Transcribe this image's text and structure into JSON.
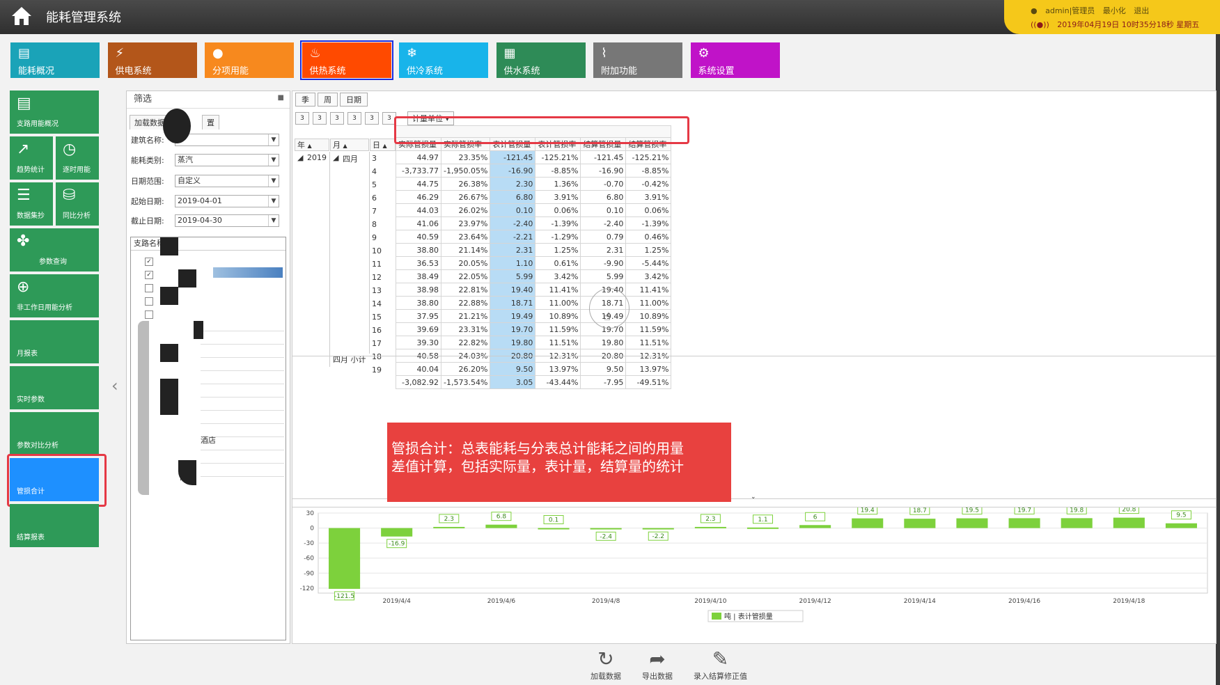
{
  "app": {
    "title": "能耗管理系统"
  },
  "user": {
    "name": "admin|管理员",
    "minimize": "最小化",
    "logout": "退出",
    "datetime": "2019年04月19日 10时35分18秒 星期五"
  },
  "nav": [
    {
      "label": "能耗概况",
      "icon": "dashboard-icon",
      "color": "#1aa3b8"
    },
    {
      "label": "供电系统",
      "icon": "power-icon",
      "color": "#b3561a"
    },
    {
      "label": "分项用能",
      "icon": "user-icon",
      "color": "#f7891e"
    },
    {
      "label": "供热系统",
      "icon": "fire-icon",
      "color": "#ff4a00"
    },
    {
      "label": "供冷系统",
      "icon": "snowflake-icon",
      "color": "#18b4ea"
    },
    {
      "label": "供水系统",
      "icon": "grid-icon",
      "color": "#2e8b57"
    },
    {
      "label": "附加功能",
      "icon": "pulse-icon",
      "color": "#777777"
    },
    {
      "label": "系统设置",
      "icon": "gear-icon",
      "color": "#c013c8"
    }
  ],
  "side": [
    {
      "label": "支路用能概况"
    },
    {
      "label": "趋势统计"
    },
    {
      "label": "逐时用能"
    },
    {
      "label": "数据集抄"
    },
    {
      "label": "同比分析"
    },
    {
      "label": "参数查询"
    },
    {
      "label": "非工作日用能分析"
    },
    {
      "label": "月报表"
    },
    {
      "label": "实时参数"
    },
    {
      "label": "参数对比分析"
    },
    {
      "label": "管损合计"
    },
    {
      "label": "结算报表"
    }
  ],
  "filter": {
    "title": "筛选",
    "tab1": "加载数据",
    "tab2": "置",
    "building_label": "建筑名称:",
    "building_value": "",
    "energy_label": "能耗类别:",
    "energy_value": "蒸汽",
    "range_label": "日期范围:",
    "range_value": "自定义",
    "start_label": "起始日期:",
    "start_value": "2019-04-01",
    "end_label": "截止日期:",
    "end_value": "2019-04-30",
    "branch_header": "支路名称",
    "branch_frag1": "酒店",
    "branch_frag2": "间"
  },
  "grid": {
    "period_tabs": [
      "季",
      "周",
      "日期"
    ],
    "small_btns": [
      "3",
      "3",
      "3",
      "3",
      "3",
      "3"
    ],
    "unit_button": "计量单位",
    "unit": "吨",
    "dims": [
      "年",
      "月",
      "日"
    ],
    "year": "2019",
    "month": "四月",
    "columns": [
      "实际管损量",
      "实际管损率",
      "表计管损量",
      "表计管损率",
      "结算管损量",
      "结算管损率"
    ],
    "rows": [
      {
        "day": "3",
        "v": [
          "44.97",
          "23.35%",
          "-121.45",
          "-125.21%",
          "-121.45",
          "-125.21%"
        ]
      },
      {
        "day": "4",
        "v": [
          "-3,733.77",
          "-1,950.05%",
          "-16.90",
          "-8.85%",
          "-16.90",
          "-8.85%"
        ]
      },
      {
        "day": "5",
        "v": [
          "44.75",
          "26.38%",
          "2.30",
          "1.36%",
          "-0.70",
          "-0.42%"
        ]
      },
      {
        "day": "6",
        "v": [
          "46.29",
          "26.67%",
          "6.80",
          "3.91%",
          "6.80",
          "3.91%"
        ]
      },
      {
        "day": "7",
        "v": [
          "44.03",
          "26.02%",
          "0.10",
          "0.06%",
          "0.10",
          "0.06%"
        ]
      },
      {
        "day": "8",
        "v": [
          "41.06",
          "23.97%",
          "-2.40",
          "-1.39%",
          "-2.40",
          "-1.39%"
        ]
      },
      {
        "day": "9",
        "v": [
          "40.59",
          "23.64%",
          "-2.21",
          "-1.29%",
          "0.79",
          "0.46%"
        ]
      },
      {
        "day": "10",
        "v": [
          "38.80",
          "21.14%",
          "2.31",
          "1.25%",
          "2.31",
          "1.25%"
        ]
      },
      {
        "day": "11",
        "v": [
          "36.53",
          "20.05%",
          "1.10",
          "0.61%",
          "-9.90",
          "-5.44%"
        ]
      },
      {
        "day": "12",
        "v": [
          "38.49",
          "22.05%",
          "5.99",
          "3.42%",
          "5.99",
          "3.42%"
        ]
      },
      {
        "day": "13",
        "v": [
          "38.98",
          "22.81%",
          "19.40",
          "11.41%",
          "19.40",
          "11.41%"
        ]
      },
      {
        "day": "14",
        "v": [
          "38.80",
          "22.88%",
          "18.71",
          "11.00%",
          "18.71",
          "11.00%"
        ]
      },
      {
        "day": "15",
        "v": [
          "37.95",
          "21.21%",
          "19.49",
          "10.89%",
          "19.49",
          "10.89%"
        ]
      },
      {
        "day": "16",
        "v": [
          "39.69",
          "23.31%",
          "19.70",
          "11.59%",
          "19.70",
          "11.59%"
        ]
      },
      {
        "day": "17",
        "v": [
          "39.30",
          "22.82%",
          "19.80",
          "11.51%",
          "19.80",
          "11.51%"
        ]
      },
      {
        "day": "18",
        "v": [
          "40.58",
          "24.03%",
          "20.80",
          "12.31%",
          "20.80",
          "12.31%"
        ]
      },
      {
        "day": "19",
        "v": [
          "40.04",
          "26.20%",
          "9.50",
          "13.97%",
          "9.50",
          "13.97%"
        ]
      }
    ],
    "subtotal_label": "四月 小计",
    "subtotal": [
      "-3,082.92",
      "-1,573.54%",
      "3.05",
      "-43.44%",
      "-7.95",
      "-49.51%"
    ]
  },
  "note": {
    "line1": "管损合计：总表能耗与分表总计能耗之间的用量",
    "line2": "差值计算，包括实际量，表计量，结算量的统计"
  },
  "chart_data": {
    "type": "bar",
    "categories": [
      "2019/4/3",
      "2019/4/4",
      "2019/4/5",
      "2019/4/6",
      "2019/4/7",
      "2019/4/8",
      "2019/4/9",
      "2019/4/10",
      "2019/4/11",
      "2019/4/12",
      "2019/4/13",
      "2019/4/14",
      "2019/4/15",
      "2019/4/16",
      "2019/4/17",
      "2019/4/18",
      "2019/4/19"
    ],
    "values": [
      -121.5,
      -16.9,
      2.3,
      6.8,
      0.1,
      -2.4,
      -2.2,
      2.3,
      1.1,
      6.0,
      19.4,
      18.7,
      19.5,
      19.7,
      19.8,
      20.8,
      9.5
    ],
    "tick_labels": [
      "2019/4/4",
      "2019/4/6",
      "2019/4/8",
      "2019/4/10",
      "2019/4/12",
      "2019/4/14",
      "2019/4/16",
      "2019/4/18"
    ],
    "y_ticks": [
      30,
      0,
      -30,
      -60,
      -90,
      -120
    ],
    "ylim": [
      -130,
      30
    ],
    "series_name": "吨 | 表计管损量",
    "color": "#7dd13c",
    "legend_position": "bottom"
  },
  "footer": {
    "reload": "加载数据",
    "export": "导出数据",
    "enter": "录入结算修正值"
  }
}
